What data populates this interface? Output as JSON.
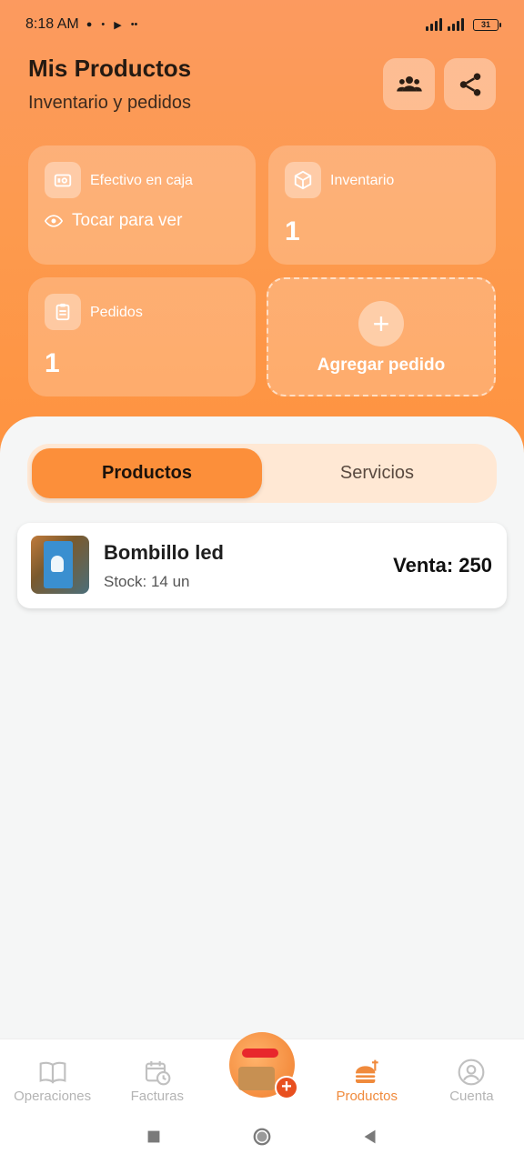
{
  "status_bar": {
    "time": "8:18 AM",
    "battery": "31"
  },
  "header": {
    "title": "Mis Productos",
    "subtitle": "Inventario y pedidos",
    "users_icon": "users-icon",
    "share_icon": "share-icon"
  },
  "cards": {
    "cash": {
      "label": "Efectivo en caja",
      "reveal_label": "Tocar para ver",
      "icon": "cash-register-icon"
    },
    "inventory": {
      "label": "Inventario",
      "value": "1",
      "icon": "box-icon"
    },
    "orders": {
      "label": "Pedidos",
      "value": "1",
      "icon": "clipboard-icon"
    },
    "add_order": {
      "label": "Agregar pedido",
      "icon": "plus-icon"
    }
  },
  "tabs": [
    {
      "label": "Productos",
      "active": true
    },
    {
      "label": "Servicios",
      "active": false
    }
  ],
  "products": [
    {
      "name": "Bombillo led",
      "stock": "Stock: 14 un",
      "price": "Venta: 250"
    }
  ],
  "bottom_nav": [
    {
      "label": "Operaciones",
      "icon": "book-icon",
      "active": false
    },
    {
      "label": "Facturas",
      "icon": "calendar-clock-icon",
      "active": false
    },
    {
      "label": "",
      "icon": "mascot-add-icon",
      "active": false
    },
    {
      "label": "Productos",
      "icon": "food-icon",
      "active": true
    },
    {
      "label": "Cuenta",
      "icon": "user-circle-icon",
      "active": false
    }
  ],
  "colors": {
    "accent": "#fc8f3a",
    "hero_top": "#fc9a5f",
    "hero_bottom": "#fe9340",
    "active_nav": "#f08a3c"
  }
}
